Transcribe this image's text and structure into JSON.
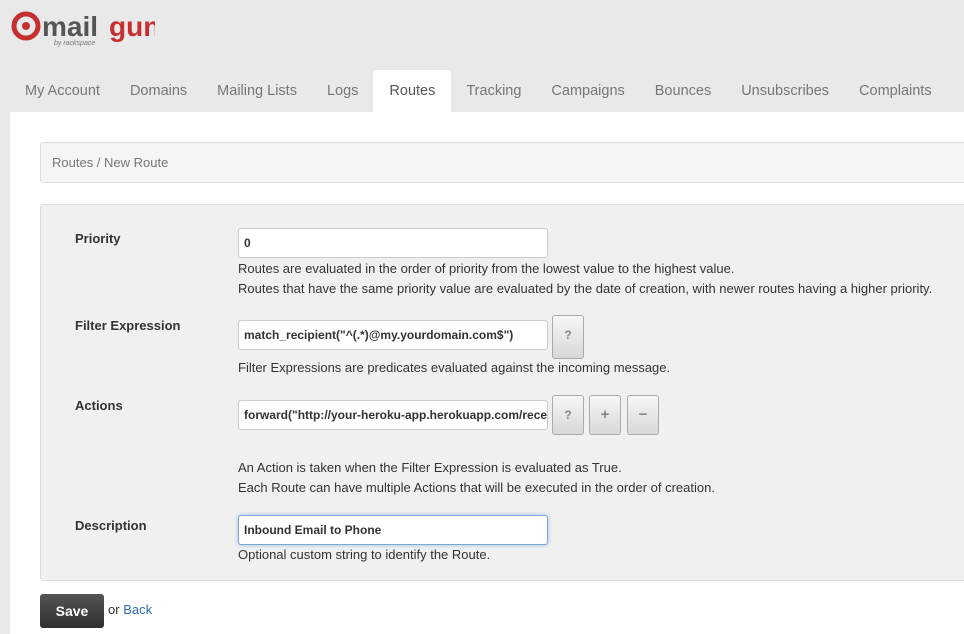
{
  "logo": {
    "text": "@mailgun",
    "sub": "by rackspace",
    "color": "#c52f2f"
  },
  "tabs": [
    {
      "label": "My Account"
    },
    {
      "label": "Domains"
    },
    {
      "label": "Mailing Lists"
    },
    {
      "label": "Logs"
    },
    {
      "label": "Routes",
      "active": true
    },
    {
      "label": "Tracking"
    },
    {
      "label": "Campaigns"
    },
    {
      "label": "Bounces"
    },
    {
      "label": "Unsubscribes"
    },
    {
      "label": "Complaints"
    }
  ],
  "breadcrumb": "Routes / New Route",
  "form": {
    "priority": {
      "label": "Priority",
      "value": "0",
      "help1": "Routes are evaluated in the order of priority from the lowest value to the highest value.",
      "help2": "Routes that have the same priority value are evaluated by the date of creation, with newer routes having a higher priority."
    },
    "filter": {
      "label": "Filter Expression",
      "value": "match_recipient(\"^(.*)@my.yourdomain.com$\")",
      "help_btn": "?",
      "help1": "Filter Expressions are predicates evaluated against the incoming message."
    },
    "actions": {
      "label": "Actions",
      "value": "forward(\"http://your-heroku-app.herokuapp.com/receive\")",
      "help_btn": "?",
      "add_btn": "+",
      "remove_btn": "−",
      "help1": "An Action is taken when the Filter Expression is evaluated as True.",
      "help2": "Each Route can have multiple Actions that will be executed in the order of creation."
    },
    "description": {
      "label": "Description",
      "value": "Inbound Email to Phone",
      "help1": "Optional custom string to identify the Route."
    }
  },
  "footer": {
    "save": "Save",
    "or": "or",
    "back": "Back"
  }
}
